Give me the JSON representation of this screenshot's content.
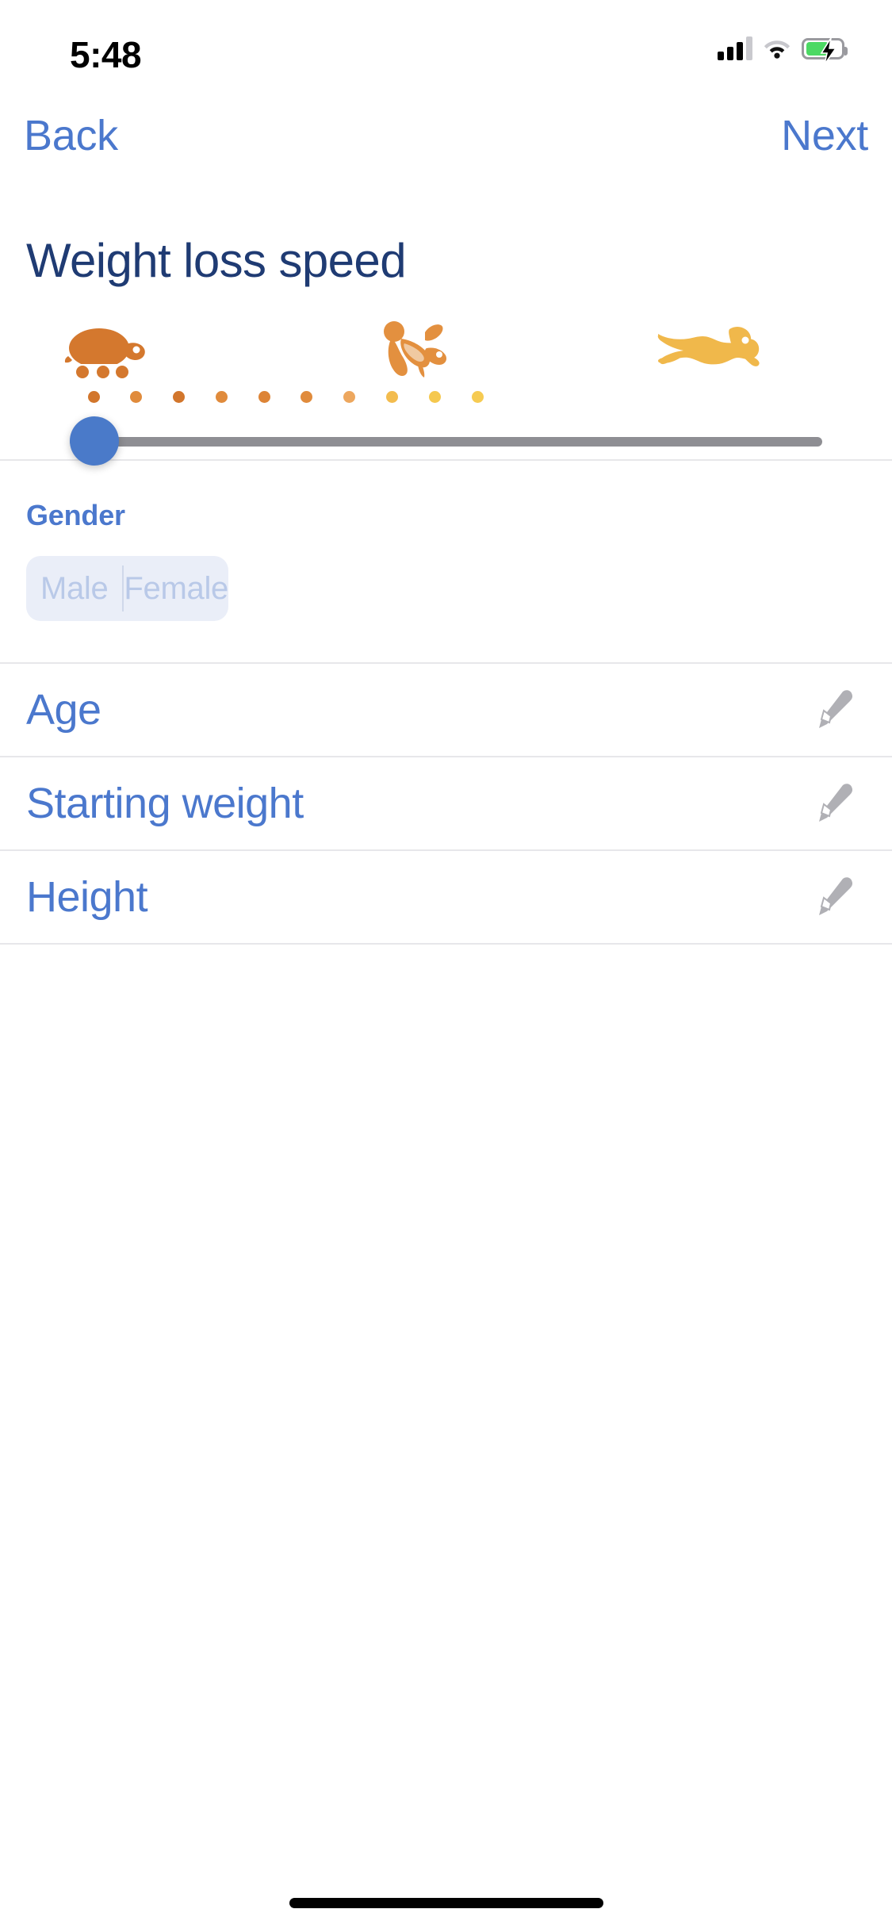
{
  "status_bar": {
    "time": "5:48",
    "cellular_icon": "cellular-bars-icon",
    "wifi_icon": "wifi-icon",
    "battery_icon": "battery-charging-icon",
    "battery_charging": true,
    "battery_fill_color": "#4cd964",
    "signal_bars_filled": 3,
    "signal_bars_total": 4
  },
  "nav": {
    "back_label": "Back",
    "next_label": "Next",
    "tint_color": "#4b78cd"
  },
  "header": {
    "title": "Weight loss speed",
    "title_color": "#1f3b73"
  },
  "speed_slider": {
    "icons": [
      {
        "name": "turtle-icon",
        "label": "slow",
        "color": "#d4782e"
      },
      {
        "name": "rabbit-icon",
        "label": "medium",
        "color": "#e3903f"
      },
      {
        "name": "cheetah-icon",
        "label": "fast",
        "color": "#f0b84b"
      }
    ],
    "dot_count": 10,
    "dot_colors": [
      "#d2762c",
      "#e08b3c",
      "#d2762c",
      "#e08b3c",
      "#dd8436",
      "#e08b3c",
      "#eda75e",
      "#f3bc4e",
      "#f5c84e",
      "#f6cb52"
    ],
    "track_color": "#8e8e93",
    "thumb_color": "#4a7ac9",
    "value_percent": 0,
    "min": 0,
    "max": 100
  },
  "gender": {
    "label": "Gender",
    "label_color": "#4b78cd",
    "options": [
      {
        "label": "Male",
        "selected": false
      },
      {
        "label": "Female",
        "selected": false
      }
    ],
    "background_color": "#eaeef8",
    "text_color": "#b9c9e8"
  },
  "measurements": {
    "rows": [
      {
        "label": "Age",
        "edit_icon": "pencil-icon",
        "value": ""
      },
      {
        "label": "Starting weight",
        "edit_icon": "pencil-icon",
        "value": ""
      },
      {
        "label": "Height",
        "edit_icon": "pencil-icon",
        "value": ""
      }
    ],
    "label_color": "#4b78cd",
    "icon_color": "#a8a8ad"
  },
  "home_indicator": {
    "present": true
  }
}
